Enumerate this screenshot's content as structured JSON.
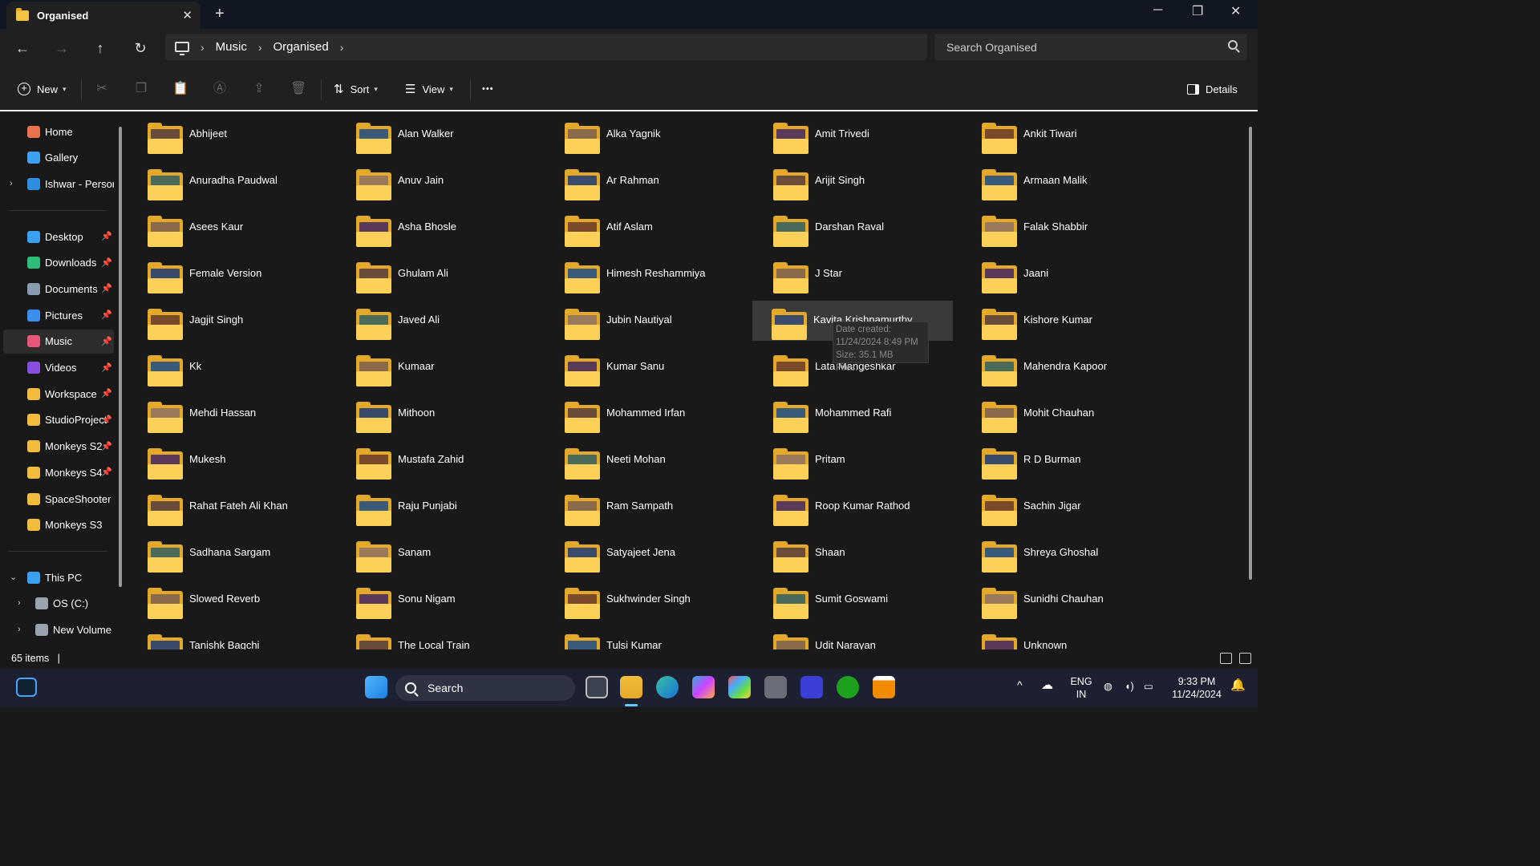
{
  "window": {
    "tab_title": "Organised",
    "controls": {
      "minimize": "─",
      "maximize": "❐",
      "close": "✕"
    }
  },
  "navigation": {
    "back": "←",
    "forward": "→",
    "up": "↑",
    "refresh": "↻"
  },
  "breadcrumb": [
    "Music",
    "Organised"
  ],
  "search": {
    "placeholder": "Search Organised"
  },
  "command_bar": {
    "new_label": "New",
    "sort_label": "Sort",
    "view_label": "View",
    "more_label": "•••",
    "details_label": "Details"
  },
  "sidebar": {
    "top": [
      {
        "label": "Home",
        "icon": "home-icon",
        "color": "#e8734c"
      },
      {
        "label": "Gallery",
        "icon": "gallery-icon",
        "color": "#3ea0f0"
      },
      {
        "label": "Ishwar - Persona",
        "icon": "onedrive-icon",
        "color": "#2e8ee0"
      }
    ],
    "quick_access": [
      {
        "label": "Desktop",
        "icon": "desktop-icon",
        "color": "#3aa0f0",
        "pinned": true
      },
      {
        "label": "Downloads",
        "icon": "download-icon",
        "color": "#2dbc7a",
        "pinned": true
      },
      {
        "label": "Documents",
        "icon": "document-icon",
        "color": "#8a9bb0",
        "pinned": true
      },
      {
        "label": "Pictures",
        "icon": "picture-icon",
        "color": "#3a8ef0",
        "pinned": true
      },
      {
        "label": "Music",
        "icon": "music-icon",
        "color": "#e8567a",
        "pinned": true,
        "selected": true
      },
      {
        "label": "Videos",
        "icon": "video-icon",
        "color": "#8a4fe0",
        "pinned": true
      },
      {
        "label": "Workspace",
        "icon": "folder-icon",
        "color": "#f2bd3c",
        "pinned": true
      },
      {
        "label": "StudioProject",
        "icon": "folder-icon",
        "color": "#f2bd3c",
        "pinned": true
      },
      {
        "label": "Monkeys S2",
        "icon": "folder-icon",
        "color": "#f2bd3c",
        "pinned": true
      },
      {
        "label": "Monkeys S4",
        "icon": "folder-icon",
        "color": "#f2bd3c",
        "pinned": true
      },
      {
        "label": "SpaceShooter",
        "icon": "folder-icon",
        "color": "#f2bd3c",
        "pinned": false
      },
      {
        "label": "Monkeys S3",
        "icon": "folder-icon",
        "color": "#f2bd3c",
        "pinned": false
      }
    ],
    "this_pc": [
      {
        "label": "This PC",
        "icon": "pc-icon",
        "color": "#3aa0f0"
      },
      {
        "label": "OS (C:)",
        "icon": "drive-icon",
        "color": "#9aa4ae"
      },
      {
        "label": "New Volume (I",
        "icon": "drive-icon",
        "color": "#9aa4ae"
      }
    ]
  },
  "folders": [
    "Abhijeet",
    "Alan Walker",
    "Alka Yagnik",
    "Amit Trivedi",
    "Ankit Tiwari",
    "Anuradha Paudwal",
    "Anuv Jain",
    "Ar Rahman",
    "Arijit Singh",
    "Armaan Malik",
    "Asees Kaur",
    "Asha Bhosle",
    "Atif Aslam",
    "Darshan Raval",
    "Falak Shabbir",
    "Female Version",
    "Ghulam Ali",
    "Himesh Reshammiya",
    "J Star",
    "Jaani",
    "Jagjit Singh",
    "Javed Ali",
    "Jubin Nautiyal",
    "Kavita Krishnamurthy",
    "Kishore Kumar",
    "Kk",
    "Kumaar",
    "Kumar Sanu",
    "Lata Mangeshkar",
    "Mahendra Kapoor",
    "Mehdi Hassan",
    "Mithoon",
    "Mohammed Irfan",
    "Mohammed Rafi",
    "Mohit Chauhan",
    "Mukesh",
    "Mustafa Zahid",
    "Neeti Mohan",
    "Pritam",
    "R D Burman",
    "Rahat Fateh Ali Khan",
    "Raju Punjabi",
    "Ram Sampath",
    "Roop Kumar Rathod",
    "Sachin Jigar",
    "Sadhana Sargam",
    "Sanam",
    "Satyajeet Jena",
    "Shaan",
    "Shreya Ghoshal",
    "Slowed Reverb",
    "Sonu Nigam",
    "Sukhwinder Singh",
    "Sumit Goswami",
    "Sunidhi Chauhan",
    "Tanishk Bagchi",
    "The Local Train",
    "Tulsi Kumar",
    "Udit Narayan",
    "Unknown"
  ],
  "hovered_folder": "Kavita Krishnamurthy",
  "tooltip": {
    "date_created": "Date created: 11/24/2024 8:49 PM",
    "size": "Size: 35.1 MB",
    "files": "Files: ..."
  },
  "status": {
    "item_count": "65 items",
    "separator": "|"
  },
  "taskbar": {
    "search_label": "Search",
    "language_line1": "ENG",
    "language_line2": "IN",
    "time": "9:33 PM",
    "date": "11/24/2024"
  },
  "colors": {
    "folder_back": "#e4a928",
    "folder_front": "#fdd058",
    "accent": "#60cdff"
  }
}
